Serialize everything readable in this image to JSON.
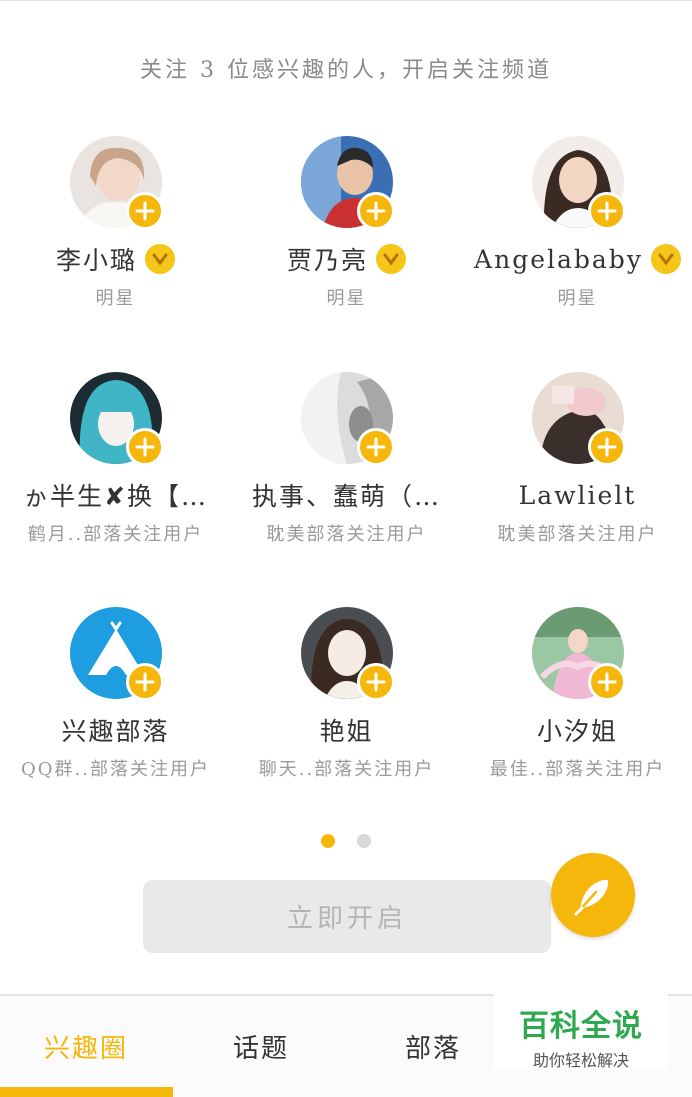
{
  "header": {
    "text": "关注 3 位感兴趣的人，开启关注频道"
  },
  "users": [
    {
      "name": "李小璐",
      "verified": true,
      "subtitle": "明星",
      "avatar": "photo-woman-light"
    },
    {
      "name": "贾乃亮",
      "verified": true,
      "subtitle": "明星",
      "avatar": "photo-man-blue"
    },
    {
      "name": "Angelababy",
      "verified": true,
      "subtitle": "明星",
      "avatar": "photo-woman-dark-hair"
    },
    {
      "name": "ゕ半生✘换【…",
      "verified": false,
      "subtitle": "鹤月..部落关注用户",
      "avatar": "photo-teal-girl"
    },
    {
      "name": "执事、蠢萌（…",
      "verified": false,
      "subtitle": "耽美部落关注用户",
      "avatar": "photo-grey-sketch"
    },
    {
      "name": "Lawlielt",
      "verified": false,
      "subtitle": "耽美部落关注用户",
      "avatar": "photo-pink-figure"
    },
    {
      "name": "兴趣部落",
      "verified": false,
      "subtitle": "QQ群..部落关注用户",
      "avatar": "tent-logo"
    },
    {
      "name": "艳姐",
      "verified": false,
      "subtitle": "聊天..部落关注用户",
      "avatar": "photo-woman-pale"
    },
    {
      "name": "小汐姐",
      "verified": false,
      "subtitle": "最佳..部落关注用户",
      "avatar": "photo-pink-dress"
    }
  ],
  "pagination": {
    "pages": 2,
    "current": 1
  },
  "start_button": {
    "label": "立即开启"
  },
  "fab": {
    "icon": "feather-pen-icon"
  },
  "tabs": [
    {
      "label": "兴趣圈",
      "active": true
    },
    {
      "label": "话题",
      "active": false
    },
    {
      "label": "部落",
      "active": false
    }
  ],
  "watermark": {
    "title": "百科全说",
    "subtitle": "助你轻松解决"
  },
  "colors": {
    "accent": "#f5b70c",
    "verified_badge": "#f5c518",
    "watermark_green": "#2fa84f"
  }
}
